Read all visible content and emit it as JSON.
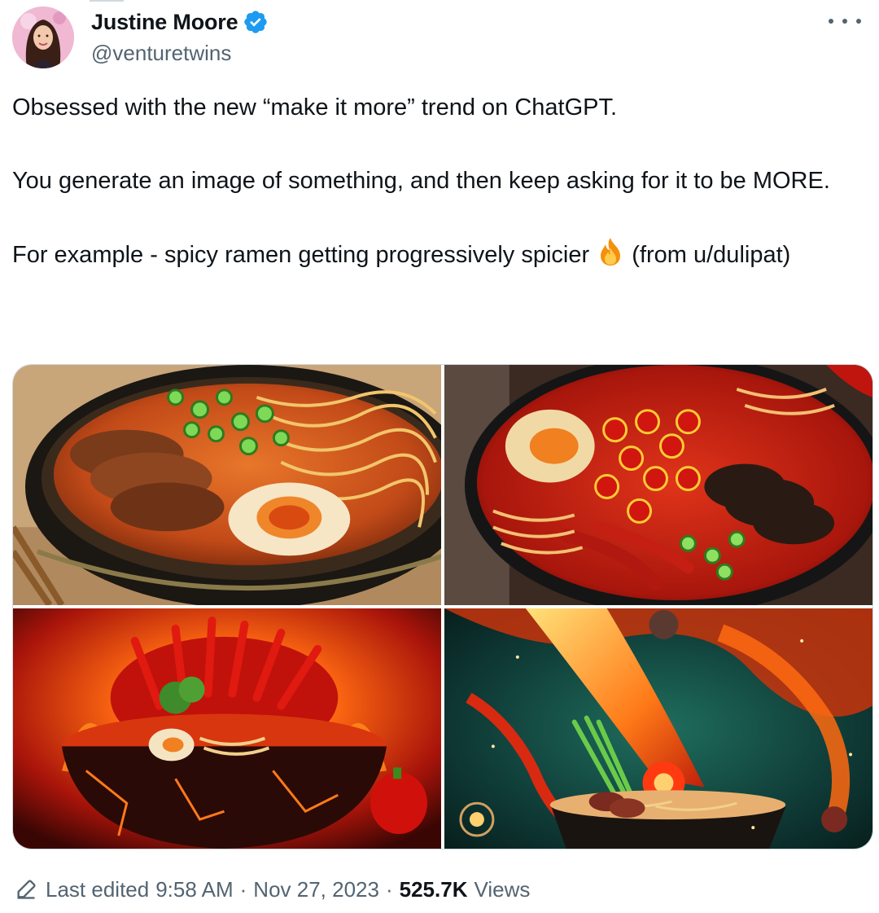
{
  "author": {
    "display_name": "Justine Moore",
    "handle": "@venturetwins",
    "verified_icon": "verified-badge-icon",
    "verified_color": "#1d9bf0"
  },
  "tweet": {
    "paragraphs": [
      "Obsessed with the new “make it more” trend on ChatGPT.",
      "You generate an image of something, and then keep asking for it to be MORE."
    ],
    "paragraph3_text": "For example - spicy ramen getting progressively spicier",
    "paragraph3_emoji": "fire-emoji",
    "paragraph3_tail": "(from u/dulipat)"
  },
  "media": {
    "images": [
      {
        "icon": "ramen-level-1-image"
      },
      {
        "icon": "ramen-level-2-image"
      },
      {
        "icon": "ramen-level-3-image"
      },
      {
        "icon": "ramen-level-4-image"
      }
    ]
  },
  "meta": {
    "edited_label": "Last edited",
    "time": "9:58 AM",
    "separator": "·",
    "date": "Nov 27, 2023",
    "views_count": "525.7K",
    "views_label": "Views"
  },
  "colors": {
    "text_primary": "#0f1419",
    "text_secondary": "#536471",
    "border": "#cfd9de"
  }
}
